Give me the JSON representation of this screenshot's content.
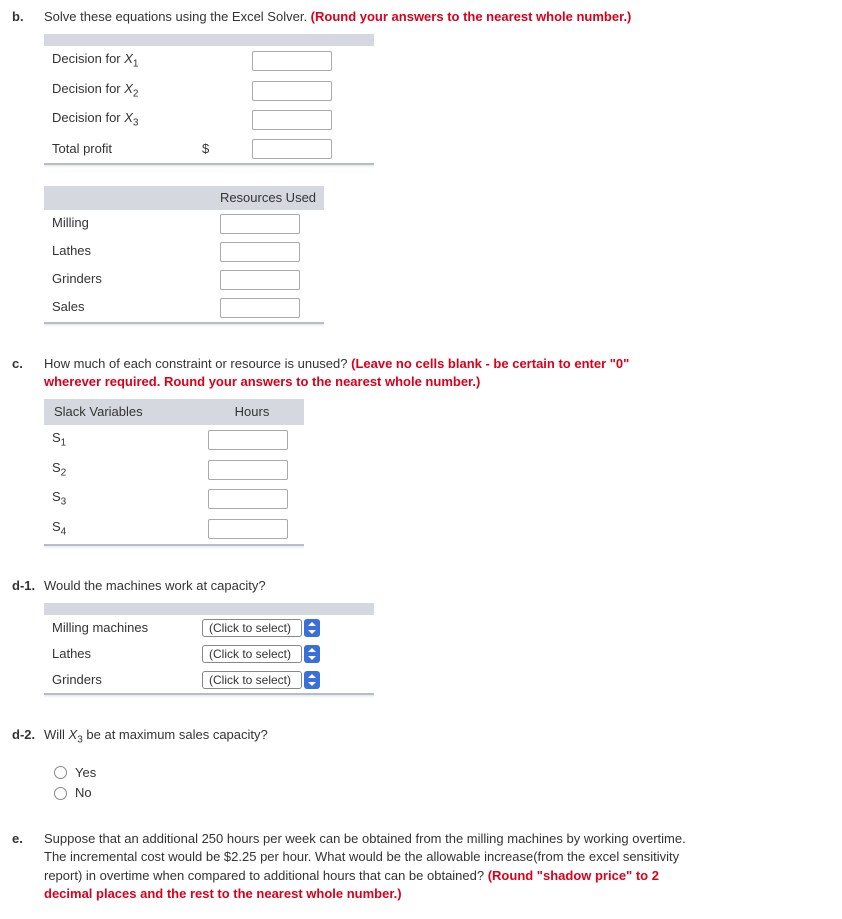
{
  "b": {
    "label": "b.",
    "text_black": "Solve these equations using the Excel Solver. ",
    "text_red": "(Round your answers to the nearest whole number.)",
    "table1": {
      "rows": [
        {
          "label_pre": "Decision for ",
          "var": "X",
          "sub": "1"
        },
        {
          "label_pre": "Decision for ",
          "var": "X",
          "sub": "2"
        },
        {
          "label_pre": "Decision for ",
          "var": "X",
          "sub": "3"
        },
        {
          "label_plain": "Total profit",
          "prefix": "$"
        }
      ]
    },
    "table2": {
      "header": "Resources Used",
      "rows": [
        "Milling",
        "Lathes",
        "Grinders",
        "Sales"
      ]
    }
  },
  "c": {
    "label": "c.",
    "text_black": "How much of each constraint or resource is unused? ",
    "text_red": "(Leave no cells blank - be certain to enter \"0\" wherever required. Round your answers to the nearest whole number.)",
    "table": {
      "h1": "Slack Variables",
      "h2": "Hours",
      "rows": [
        {
          "var": "S",
          "sub": "1"
        },
        {
          "var": "S",
          "sub": "2"
        },
        {
          "var": "S",
          "sub": "3"
        },
        {
          "var": "S",
          "sub": "4"
        }
      ]
    }
  },
  "d1": {
    "label": "d-1.",
    "text": "Would the machines work at capacity?",
    "table": {
      "rows": [
        "Milling machines",
        "Lathes",
        "Grinders"
      ],
      "select_placeholder": "(Click to select)"
    }
  },
  "d2": {
    "label": "d-2.",
    "text_pre": "Will ",
    "var": "X",
    "sub": "3",
    "text_post": " be at maximum sales capacity?",
    "options": [
      "Yes",
      "No"
    ]
  },
  "e": {
    "label": "e.",
    "text_black": "Suppose that an additional 250 hours per week can be obtained from the milling machines by working overtime. The incremental cost would be $2.25 per hour. What would be the allowable increase(from the excel sensitivity report) in overtime when compared to additional hours that can be obtained? ",
    "text_red": "(Round \"shadow price\" to 2 decimal places and the rest to the nearest whole number.)"
  }
}
